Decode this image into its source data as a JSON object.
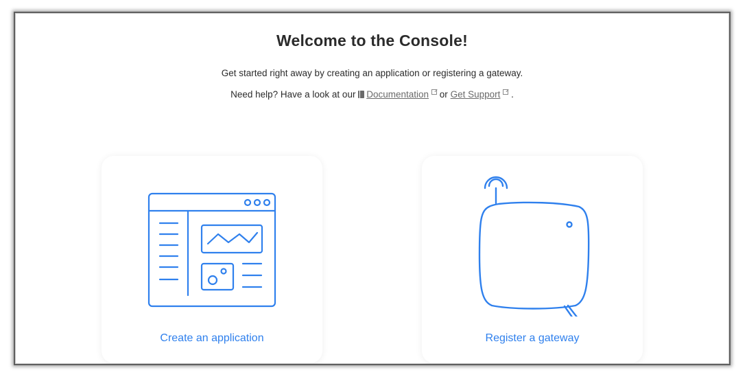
{
  "header": {
    "title": "Welcome to the Console!",
    "subtitle": "Get started right away by creating an application or registering a gateway.",
    "help_prefix": "Need help? Have a look at our",
    "documentation_link": "Documentation",
    "or_text": "or",
    "support_link": "Get Support",
    "suffix": "."
  },
  "cards": {
    "application": {
      "label": "Create an application",
      "icon": "application-window-icon"
    },
    "gateway": {
      "label": "Register a gateway",
      "icon": "gateway-device-icon"
    }
  },
  "colors": {
    "accent": "#2f80ed",
    "text": "#2b2b2b",
    "link": "#6a6a6a"
  }
}
